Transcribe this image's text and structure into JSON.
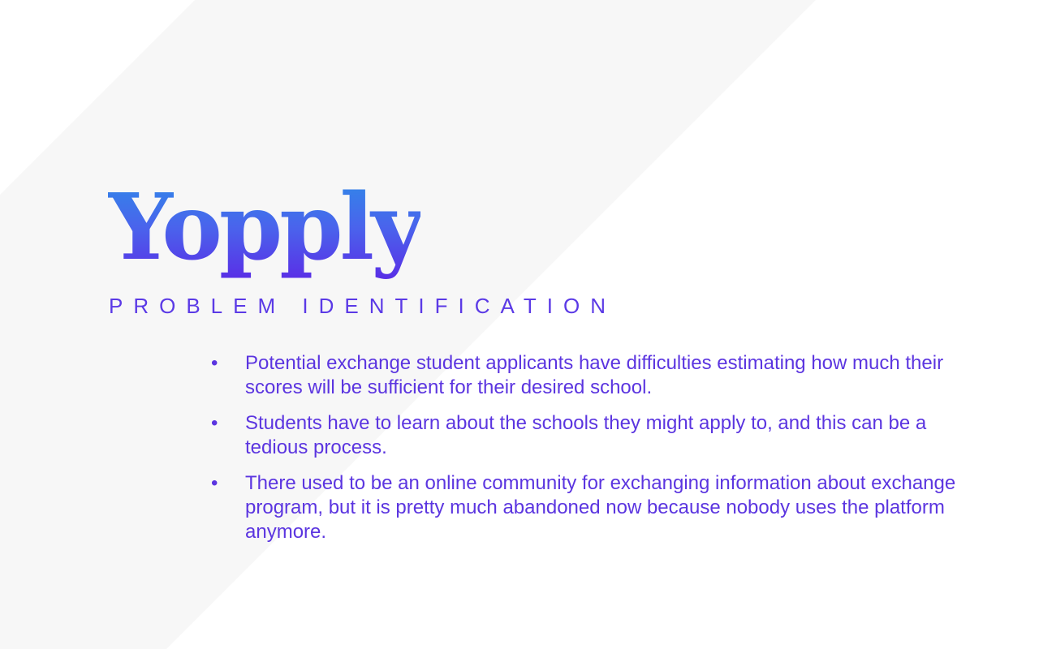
{
  "slide": {
    "logo_text": "Yopply",
    "subtitle": "PROBLEM IDENTIFICATION",
    "bullet_glyph": "•",
    "points": [
      "Potential exchange student applicants have difficulties estimating how much their scores will be sufficient for their desired school.",
      "Students have to learn about the schools they might apply to, and this can be a tedious process.",
      "There used to be an online community for exchanging information about exchange program, but it is pretty much abandoned now because nobody uses the platform anymore."
    ]
  },
  "colors": {
    "background": "#ffffff",
    "band": "#f7f7f7",
    "logo_gradient_top": "#2f8ae8",
    "logo_gradient_bottom": "#5a2de6",
    "text_purple": "#5b35e0"
  }
}
